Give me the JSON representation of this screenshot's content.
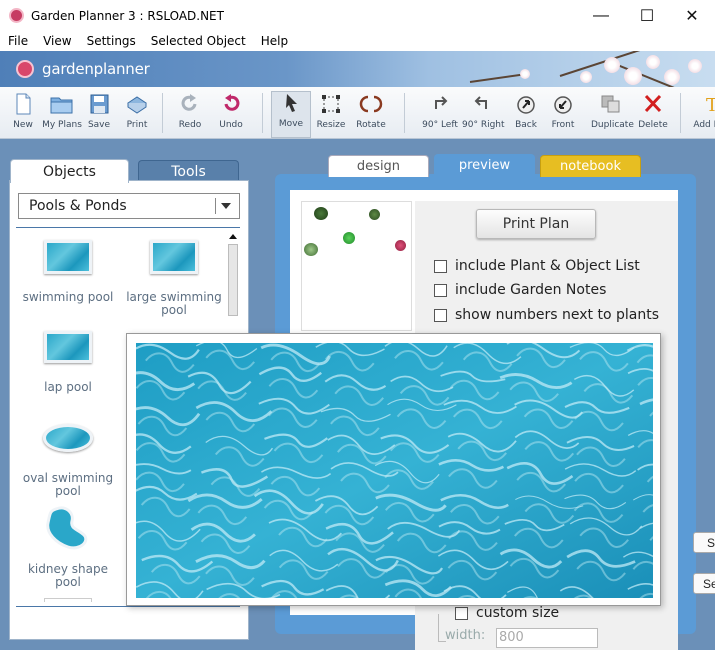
{
  "window": {
    "title": "Garden Planner 3 : RSLOAD.NET",
    "controls": {
      "minimize": "—",
      "maximize": "☐",
      "close": "✕"
    }
  },
  "menu": [
    "File",
    "View",
    "Settings",
    "Selected Object",
    "Help"
  ],
  "brand": {
    "logo_text": "gardenplanner"
  },
  "toolbar": {
    "new": "New",
    "my_plans": "My Plans",
    "save": "Save",
    "print": "Print",
    "redo": "Redo",
    "undo": "Undo",
    "move": "Move",
    "resize": "Resize",
    "rotate": "Rotate",
    "rot_left": "90° Left",
    "rot_right": "90° Right",
    "back": "Back",
    "front": "Front",
    "duplicate": "Duplicate",
    "delete": "Delete",
    "add_label": "Add L"
  },
  "left_panel": {
    "tabs": {
      "objects": "Objects",
      "tools": "Tools"
    },
    "category": "Pools & Ponds",
    "items": [
      {
        "label_line1": "swimming pool",
        "label_line2": ""
      },
      {
        "label_line1": "large swimming",
        "label_line2": "pool"
      },
      {
        "label_line1": "lap pool",
        "label_line2": ""
      },
      {
        "label_line1": "oval swimming",
        "label_line2": "pool"
      },
      {
        "label_line1": "kidney shape pool",
        "label_line2": ""
      }
    ]
  },
  "main_tabs": {
    "design": "design",
    "preview": "preview",
    "notebook": "notebook"
  },
  "preview": {
    "print_button": "Print Plan",
    "options": [
      "include Plant & Object List",
      "include Garden Notes",
      "show numbers next to plants"
    ],
    "custom_size": "custom size",
    "width_label": "width:",
    "width_value": "800"
  },
  "side_buttons": [
    "S",
    "Se"
  ],
  "colors": {
    "accent": "#5b9bd6",
    "notebook_tab": "#e7be22",
    "water": "#2aa7c9"
  }
}
